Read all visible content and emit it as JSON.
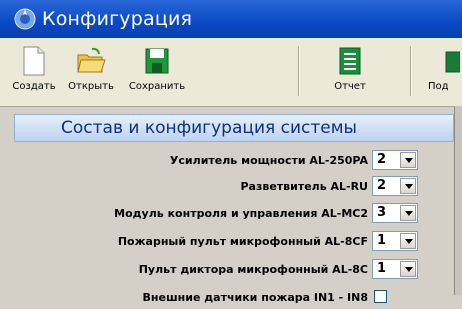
{
  "window": {
    "title": "Конфигурация"
  },
  "toolbar": {
    "buttons": [
      {
        "label": "Создать",
        "icon": "new-file-icon"
      },
      {
        "label": "Открыть",
        "icon": "open-folder-icon"
      },
      {
        "label": "Сохранить",
        "icon": "save-disk-icon"
      },
      {
        "label": "Отчет",
        "icon": "report-icon"
      },
      {
        "label": "Под",
        "icon": "cut-off-icon"
      }
    ]
  },
  "panel": {
    "title": "Состав и конфигурация системы",
    "rows": [
      {
        "label": "Усилитель мощности AL-250PA",
        "value": "2"
      },
      {
        "label": "Разветвитель AL-RU",
        "value": "2"
      },
      {
        "label": "Модуль контроля и управления AL-MC2",
        "value": "3"
      },
      {
        "label": "Пожарный пульт микрофонный AL-8CF",
        "value": "1"
      },
      {
        "label": "Пульт диктора микрофонный AL-8C",
        "value": "1"
      },
      {
        "label": "Внешние датчики пожара IN1 - IN8",
        "value": ""
      }
    ]
  },
  "colors": {
    "titlebar": "#0a49c4",
    "panel_header_text": "#102f84",
    "toolbar_bg": "#ece9d8"
  }
}
